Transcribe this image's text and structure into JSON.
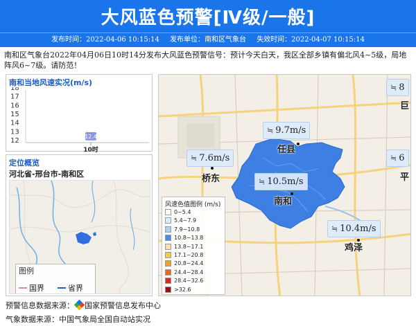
{
  "header": {
    "title": "大风蓝色预警[Ⅳ级/一般]",
    "issue_time": "发布时间：2022-04-06 10:15:14",
    "issuer": "发布单位：南和区气象台",
    "expire_time": "失效时间：2022-04-07 10:15:14"
  },
  "summary": "南和区气象台2022年04月06日10时14分发布大风蓝色预警信号：预计今天白天，我区全部乡镇有偏北风4~5级，局地阵风6~7级。请防范！",
  "wind_panel": {
    "title": "南和当地风速实况(m/s)",
    "yticks": [
      "18",
      "17",
      "16",
      "15",
      "14",
      "13",
      "12"
    ],
    "point_value": "12.4",
    "x_label": "10时"
  },
  "chart_data": {
    "type": "scatter",
    "title": "南和当地风速实况(m/s)",
    "x": [
      "10时"
    ],
    "values": [
      12.4
    ],
    "ylim": [
      12,
      18
    ]
  },
  "location": {
    "title": "定位概览",
    "path": "河北省-邢台市-南和区",
    "legend_title": "图例",
    "legend_items": [
      "国界",
      "省界"
    ],
    "legend_colors": [
      "#d98c96",
      "#1a5dc8"
    ]
  },
  "map": {
    "stations": [
      {
        "value": "9.7m/s",
        "city": "任县"
      },
      {
        "value": "7.6m/s",
        "city": "桥东"
      },
      {
        "value": "10.5m/s",
        "city": "南和"
      },
      {
        "value": "10.4m/s",
        "city": "鸡泽"
      },
      {
        "value": "8",
        "city": "巨"
      },
      {
        "value": "6",
        "city": "平"
      }
    ],
    "wind_icon": "wind-icon",
    "legend_title": "风速色值图例 (m/s)",
    "legend": [
      {
        "label": "0~5.4",
        "color": "#ffffff"
      },
      {
        "label": "5.4~7.9",
        "color": "#dceefc"
      },
      {
        "label": "7.9~10.8",
        "color": "#a9d4f7"
      },
      {
        "label": "10.8~13.8",
        "color": "#4c8ce6"
      },
      {
        "label": "13.8~17.1",
        "color": "#f8e0a8"
      },
      {
        "label": "17.1~20.8",
        "color": "#f6c84f"
      },
      {
        "label": "20.8~24.4",
        "color": "#f3a31e"
      },
      {
        "label": "24.4~28.4",
        "color": "#ea6b1d"
      },
      {
        "label": "28.4~32.6",
        "color": "#d72e1b"
      },
      {
        "label": ">32.6",
        "color": "#9b1111"
      }
    ]
  },
  "footer": {
    "warn_source_label": "预警信息数据来源：",
    "warn_source": "国家预警信息发布中心",
    "weather_source": "气象数据来源：中国气象局全国自动站实况"
  }
}
